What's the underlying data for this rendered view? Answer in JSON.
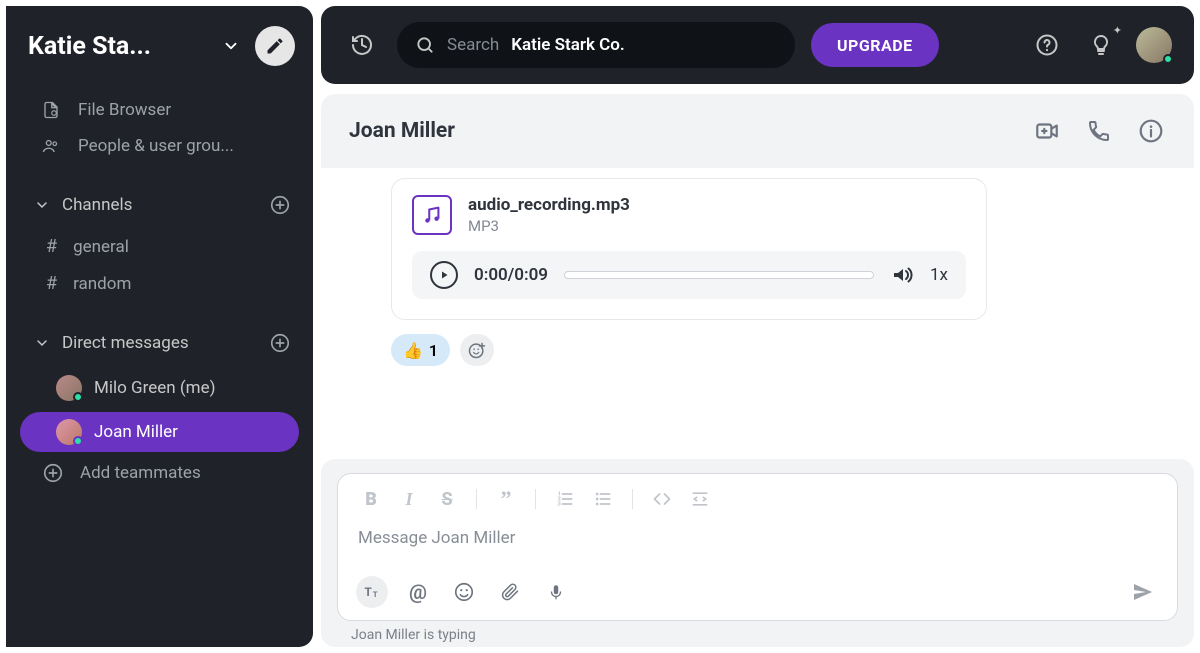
{
  "workspace": {
    "name": "Katie Sta..."
  },
  "sidebar": {
    "file_browser": "File Browser",
    "people_groups": "People & user grou...",
    "channels_label": "Channels",
    "channels": [
      {
        "name": "general"
      },
      {
        "name": "random"
      }
    ],
    "dm_label": "Direct messages",
    "dms": [
      {
        "name": "Milo Green (me)"
      },
      {
        "name": "Joan Miller"
      }
    ],
    "add_teammates": "Add teammates"
  },
  "topbar": {
    "search_placeholder": "Search",
    "search_org": "Katie Stark Co.",
    "upgrade": "UPGRADE"
  },
  "chat": {
    "title": "Joan Miller",
    "attachment": {
      "filename": "audio_recording.mp3",
      "filetype": "MP3",
      "time": "0:00/0:09",
      "speed": "1x"
    },
    "reaction": {
      "emoji": "👍",
      "count": "1"
    },
    "composer_placeholder": "Message Joan Miller",
    "typing": "Joan Miller is typing"
  }
}
